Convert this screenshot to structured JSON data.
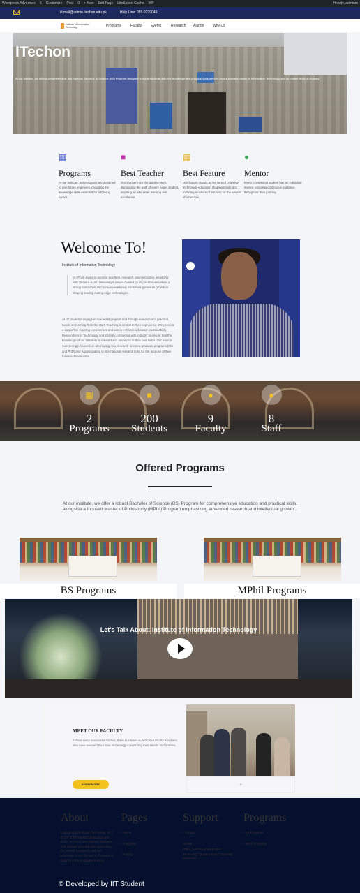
{
  "admin_bar": {
    "items": [
      "Wordpress Adventure",
      "6",
      "Customize",
      "Post",
      "0",
      "+ New",
      "Edit Page",
      "LiteSpeed Cache",
      "WP"
    ],
    "right": "Howdy, adminm"
  },
  "topbar": {
    "email": "iit.mail@admin.itechon.edu.pk",
    "phone": "Help Line: 055-9239049"
  },
  "nav": {
    "logo_text": "Institute of Information Technology",
    "items": [
      "Programs",
      "Faculty",
      "Events",
      "Research",
      "Alumni",
      "Why Us"
    ]
  },
  "hero": {
    "title": "ITechon",
    "tagline": "At our institute, we offer a comprehensive and rigorous Bachelor of Science (BS) Program designed to equip students with the knowledge and practical skills needed for a successful career in Information Technology and its related fields of industry."
  },
  "features": [
    {
      "icon": "book-icon",
      "color": "#3b4fc4",
      "title": "Programs",
      "text": "At our institute, our programs are designed to give future engineers, providing the knowledge skills essential for a thriving career."
    },
    {
      "icon": "teacher-icon",
      "color": "#c030a8",
      "title": "Best Teacher",
      "text": "Our teachers are the guiding stars, illuminating the path of every eager student, inspiring all who enter learning and excellence."
    },
    {
      "icon": "building-icon",
      "color": "#e0b21c",
      "title": "Best Feature",
      "text": "Our feature stands at the core of cognitive technology education shaping minds and fostering a culture of success for the leaders of tomorrow."
    },
    {
      "icon": "mentor-icon",
      "color": "#3aa655",
      "title": "Mentor",
      "text": "Every exceptional student has an individual mentor, ensuring continuous guidance throughout their journey."
    }
  ],
  "welcome": {
    "heading": "Welcome To!",
    "subheading": "Institute of Information Technology",
    "quote": "At IIT we aspire to excel in teaching, research, and innovation, engaging with Quaid-e-Azam University's vision. Guided by its passion we deliver a strong foundation and pursue excellence, contributing towards growth in shaping leading cutting-edge technologies.",
    "body": "At IIT, students engage in real world projects and through research and practical, hands-on learning from the start. Teaching is central to their experience. We promote a supportive learning environment and aim to enhance education sustainability. Researchers in Technology and strongly connected with industry to ensure that the knowledge of our students is relevant and advances in their own fields. Our team is now strongly focused on developing new research-oriented graduate programs (MS and PhD) and is participating in international research links for the purpose of their future achievements."
  },
  "stats": [
    {
      "icon": "book-icon",
      "number": "2",
      "label": "Programs"
    },
    {
      "icon": "student-icon",
      "number": "200",
      "label": "Students"
    },
    {
      "icon": "faculty-icon",
      "number": "9",
      "label": "Faculty"
    },
    {
      "icon": "staff-icon",
      "number": "8",
      "label": "Staff"
    }
  ],
  "offered": {
    "heading": "Offered Programs",
    "text": "At our institute, we offer a robust Bachelor of Science (BS) Program for comprehensive education and practical skills, alongside a focused Master of Philosophy (MPhil) Program emphasizing advanced research and intellectual growth...",
    "programs": [
      "BS Programs",
      "MPhil Programs"
    ]
  },
  "video": {
    "title": "Let's Talk About: Institute of Information Technology"
  },
  "faculty": {
    "heading": "MEET OUR FACULTY",
    "text": "Behind every successful student, there is a team of dedicated faculty members who have invested their time and energy in nurturing their talents and abilities.",
    "button": "KNOW MORE",
    "carousel_label": "+"
  },
  "footer": {
    "about_title": "About",
    "about_text": "Institute of Information Technology (IIT) is one of the leading information and public technical and research institutes. The institute of information technology (iit) started functioning with the admission of the first batch of Master of Science in the computer science.",
    "pages_title": "Pages",
    "pages": [
      "Home",
      "Programs",
      "Faculty"
    ],
    "support_title": "Support",
    "support": [
      "Contact",
      "Email"
    ],
    "support_address": "Office: Institute of Information Technology, Quaid-e-Azam University, Islamabad",
    "programs_title": "Programs",
    "programs": [
      "BS Programs",
      "MPhil Programs"
    ],
    "copyright": "© Developed by IIT Student"
  }
}
